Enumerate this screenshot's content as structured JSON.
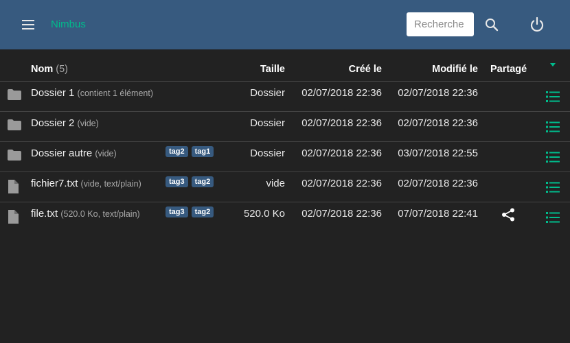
{
  "header": {
    "app_name": "Nimbus",
    "search_placeholder": "Recherche",
    "accent_color": "#00bc8c",
    "bar_color": "#375a7f"
  },
  "table": {
    "columns": {
      "name": "Nom",
      "count": "(5)",
      "size": "Taille",
      "created": "Créé le",
      "modified": "Modifié le",
      "shared": "Partagé"
    },
    "rows": [
      {
        "icon": "folder-icon",
        "name": "Dossier 1",
        "desc": "(contient 1 élément)",
        "tags": [],
        "size": "Dossier",
        "created": "02/07/2018 22:36",
        "modified": "02/07/2018 22:36",
        "shared": false
      },
      {
        "icon": "folder-icon",
        "name": "Dossier 2",
        "desc": "(vide)",
        "tags": [],
        "size": "Dossier",
        "created": "02/07/2018 22:36",
        "modified": "02/07/2018 22:36",
        "shared": false
      },
      {
        "icon": "folder-icon",
        "name": "Dossier autre",
        "desc": "(vide)",
        "tags": [
          "tag2",
          "tag1"
        ],
        "size": "Dossier",
        "created": "02/07/2018 22:36",
        "modified": "03/07/2018 22:55",
        "shared": false
      },
      {
        "icon": "file-icon",
        "name": "fichier7.txt",
        "desc": "(vide, text/plain)",
        "tags": [
          "tag3",
          "tag2"
        ],
        "size": "vide",
        "created": "02/07/2018 22:36",
        "modified": "02/07/2018 22:36",
        "shared": false
      },
      {
        "icon": "file-icon",
        "name": "file.txt",
        "desc": "(520.0 Ko, text/plain)",
        "tags": [
          "tag3",
          "tag2"
        ],
        "size": "520.0 Ko",
        "created": "02/07/2018 22:36",
        "modified": "07/07/2018 22:41",
        "shared": true
      }
    ]
  }
}
